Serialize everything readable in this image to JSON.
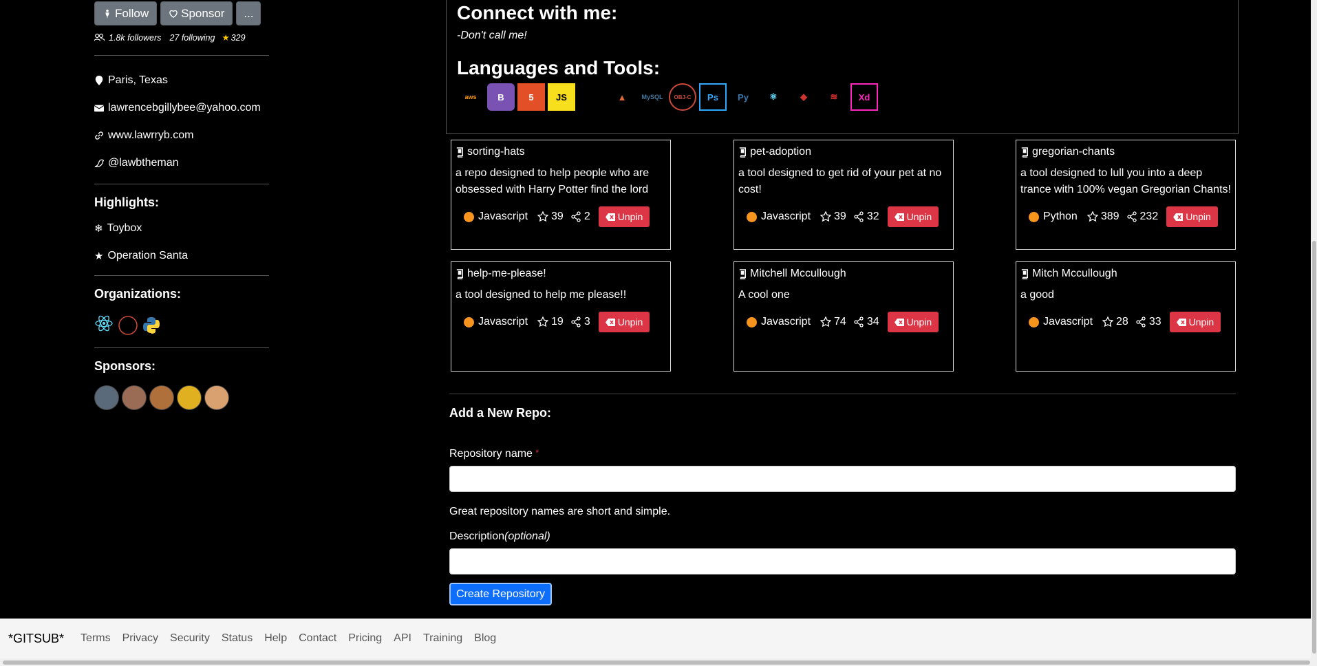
{
  "sidebar": {
    "follow_label": "Follow",
    "sponsor_label": "Sponsor",
    "more_label": "...",
    "followers": "1.8k followers",
    "following": "27 following",
    "stars": "329",
    "location": "Paris, Texas",
    "email": "lawrencebgillybee@yahoo.com",
    "website": "www.lawrryb.com",
    "twitter": "@lawbtheman",
    "highlights_title": "Highlights:",
    "highlights": [
      "Toybox",
      "Operation Santa"
    ],
    "orgs_title": "Organizations:",
    "orgs": [
      "react-icon",
      "objective-c-icon",
      "python-icon"
    ],
    "sponsors_title": "Sponsors:",
    "sponsor_avatar_colors": [
      "#5a6a7a",
      "#9a6b55",
      "#b0703c",
      "#e0b020",
      "#d9a070"
    ]
  },
  "readme": {
    "connect_title": "Connect with me:",
    "connect_quote": "-Don't call me!",
    "tools_title": "Languages and Tools:",
    "tools": [
      {
        "name": "aws-icon",
        "label": "aws",
        "color": "#ff9900"
      },
      {
        "name": "bootstrap-icon",
        "label": "B",
        "color": "#7952b3"
      },
      {
        "name": "html5-icon",
        "label": "5",
        "color": "#e34f26"
      },
      {
        "name": "javascript-icon",
        "label": "JS",
        "color": "#f7df1e"
      },
      {
        "name": "blank-icon",
        "label": "",
        "color": "transparent"
      },
      {
        "name": "matlab-icon",
        "label": "▲",
        "color": "#e16737"
      },
      {
        "name": "mysql-icon",
        "label": "MySQL",
        "color": "#4479a1"
      },
      {
        "name": "objective-c-icon",
        "label": "OBJ-C",
        "color": "#d04a3a"
      },
      {
        "name": "photoshop-icon",
        "label": "Ps",
        "color": "#31a8ff"
      },
      {
        "name": "python-icon",
        "label": "Py",
        "color": "#3776ab"
      },
      {
        "name": "react-icon",
        "label": "⚛",
        "color": "#61dafb"
      },
      {
        "name": "ruby-icon",
        "label": "◆",
        "color": "#cc342d"
      },
      {
        "name": "scala-icon",
        "label": "≋",
        "color": "#dc322f"
      },
      {
        "name": "xd-icon",
        "label": "Xd",
        "color": "#ff26be"
      }
    ]
  },
  "repos": [
    {
      "name": "sorting-hats",
      "desc": "a repo designed to help people who are obsessed with Harry Potter find the lord",
      "lang": "Javascript",
      "stars": "39",
      "forks": "2"
    },
    {
      "name": "pet-adoption",
      "desc": "a tool designed to get rid of your pet at no cost!",
      "lang": "Javascript",
      "stars": "39",
      "forks": "32"
    },
    {
      "name": "gregorian-chants",
      "desc": "a tool designed to lull you into a deep trance with 100% vegan Gregorian Chants!",
      "lang": "Python",
      "stars": "389",
      "forks": "232"
    },
    {
      "name": "help-me-please!",
      "desc": "a tool designed to help me please!!",
      "lang": "Javascript",
      "stars": "19",
      "forks": "3"
    },
    {
      "name": "Mitchell Mccullough",
      "desc": "A cool one",
      "lang": "Javascript",
      "stars": "74",
      "forks": "34"
    },
    {
      "name": "Mitch Mccullough",
      "desc": "a good",
      "lang": "Javascript",
      "stars": "28",
      "forks": "33"
    }
  ],
  "unpin_label": "Unpin",
  "form": {
    "title": "Add a New Repo:",
    "repo_name_label": "Repository name",
    "required_mark": "*",
    "hint": "Great repository names are short and simple.",
    "description_label": "Description",
    "optional_label": "(optional)",
    "create_label": "Create Repository"
  },
  "footer": {
    "brand": "*GITSUB*",
    "links": [
      "Terms",
      "Privacy",
      "Security",
      "Status",
      "Help",
      "Contact",
      "Pricing",
      "API",
      "Training",
      "Blog"
    ]
  }
}
